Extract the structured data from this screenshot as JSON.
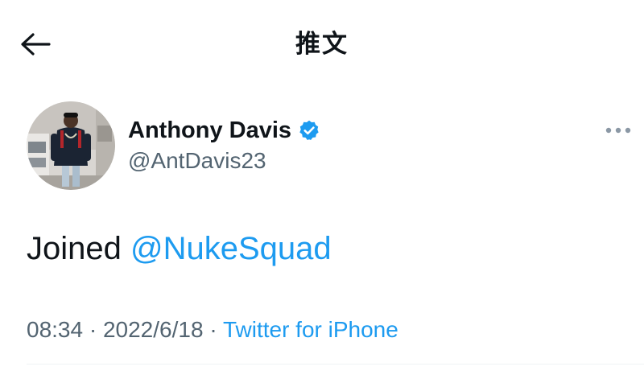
{
  "header": {
    "title": "推文",
    "back_icon": "arrow-left-icon"
  },
  "author": {
    "name": "Anthony Davis",
    "handle": "@AntDavis23",
    "verified": true,
    "verified_color": "#1d9bf0",
    "avatar_icon": "profile-photo"
  },
  "tweet": {
    "text_prefix": "Joined",
    "mention": "@NukeSquad"
  },
  "meta": {
    "time": "08:34",
    "separator": " · ",
    "date": "2022/6/18",
    "source": "Twitter for iPhone"
  },
  "colors": {
    "link": "#1d9bf0",
    "secondary": "#536471",
    "primary_text": "#0f1419"
  }
}
